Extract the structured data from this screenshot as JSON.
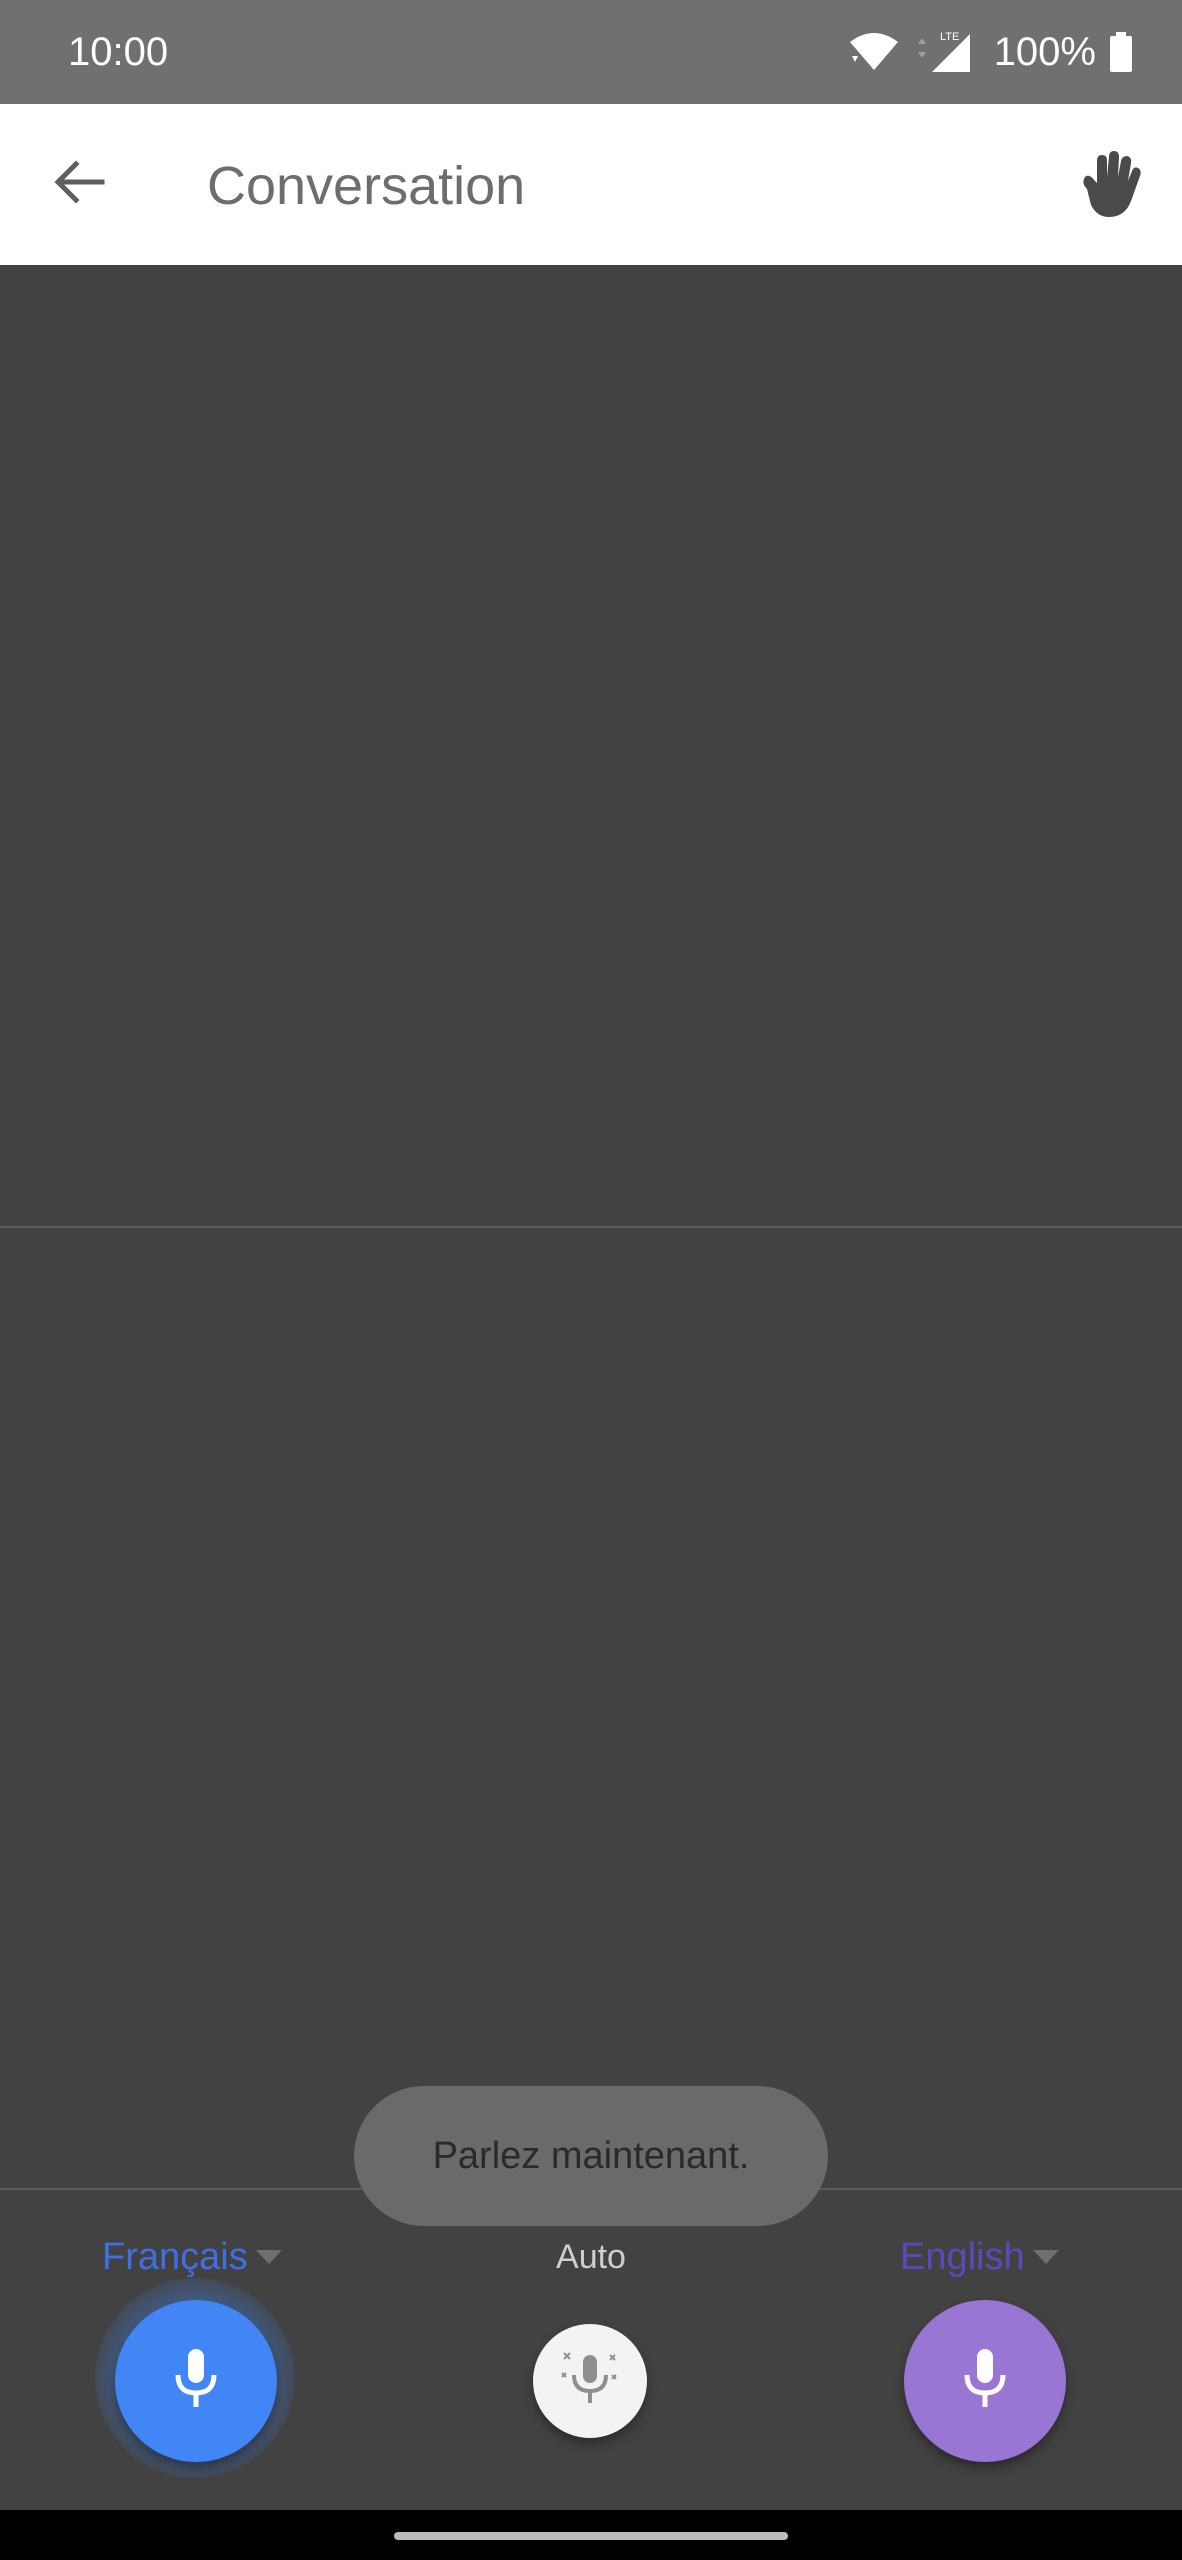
{
  "status_bar": {
    "time": "10:00",
    "network_label": "LTE",
    "battery": "100%",
    "icons": [
      "wifi-icon",
      "signal-icon",
      "battery-icon"
    ]
  },
  "app_bar": {
    "title": "Conversation",
    "back_icon": "arrow-back-icon",
    "action_icon": "hand-icon"
  },
  "controls": {
    "left_language": "Français",
    "center_mode": "Auto",
    "right_language": "English",
    "left_mic_color": "#4285f4",
    "auto_mic_color": "#f3f3f3",
    "right_mic_color": "#9a76d4"
  },
  "toast": {
    "message": "Parlez maintenant."
  },
  "colors": {
    "background": "#424242",
    "status_bar": "#707070",
    "app_bar": "#ffffff",
    "left_language_text": "#3f6fe0",
    "right_language_text": "#5b4ab8"
  }
}
